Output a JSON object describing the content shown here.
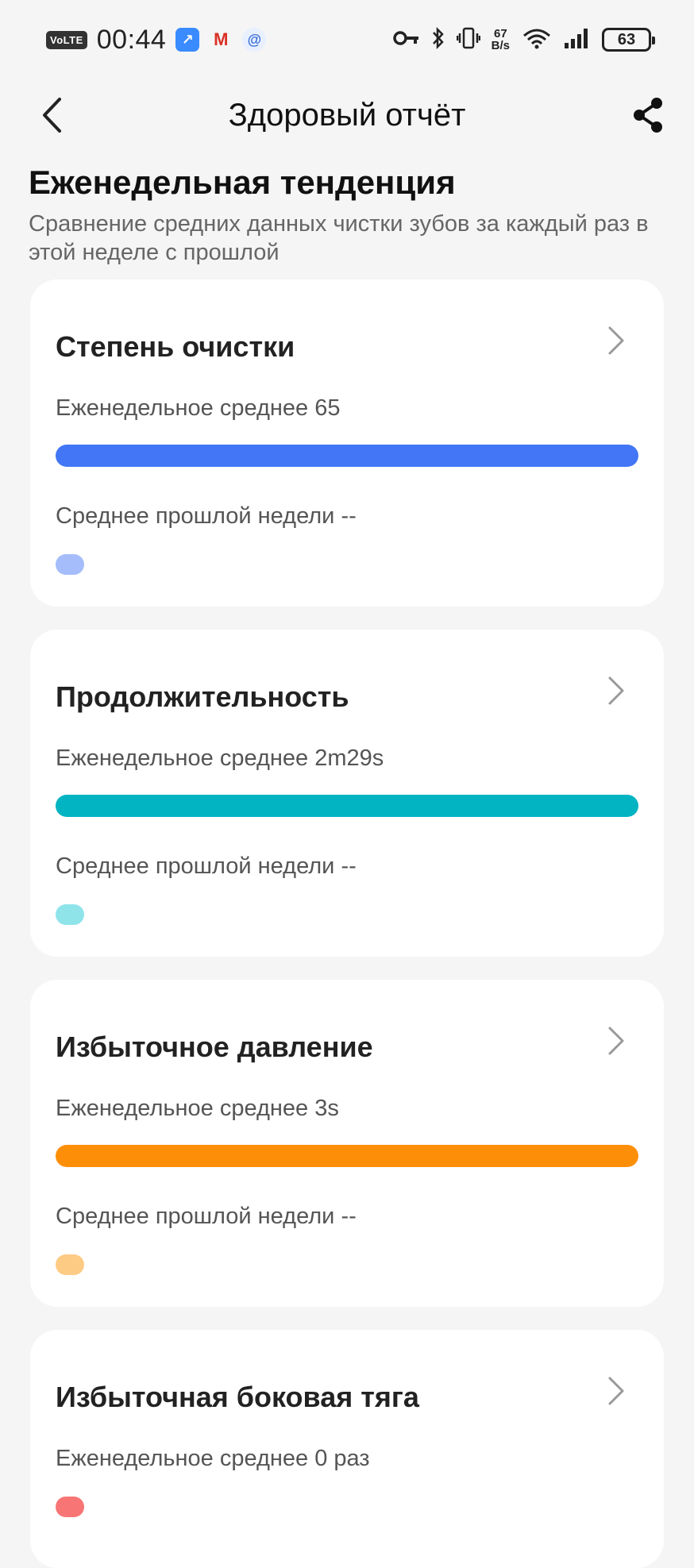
{
  "status_bar": {
    "volte": "VoLTE",
    "time": "00:44",
    "net_speed_value": "67",
    "net_speed_unit": "B/s",
    "battery": "63"
  },
  "header": {
    "title": "Здоровый отчёт"
  },
  "section": {
    "title": "Еженедельная тенденция",
    "subtitle": "Сравнение средних данных чистки зубов за каждый раз в этой неделе с прошлой"
  },
  "cards": [
    {
      "title": "Степень очистки",
      "weekly_label": "Еженедельное среднее 65",
      "last_week_label": "Среднее прошлой недели --",
      "bar_color": "#4276f6",
      "dot_color": "#a5bdfb",
      "weekly_fill": 1.0
    },
    {
      "title": "Продолжительность",
      "weekly_label": "Еженедельное среднее 2m29s",
      "last_week_label": "Среднее прошлой недели --",
      "bar_color": "#02b4c2",
      "dot_color": "#8fe4ea",
      "weekly_fill": 1.0
    },
    {
      "title": "Избыточное давление",
      "weekly_label": "Еженедельное среднее 3s",
      "last_week_label": "Среднее прошлой недели --",
      "bar_color": "#fd8f08",
      "dot_color": "#fdcb84",
      "weekly_fill": 1.0
    },
    {
      "title": "Избыточная боковая тяга",
      "weekly_label": "Еженедельное среднее 0 раз",
      "dot_color": "#f87575"
    }
  ]
}
